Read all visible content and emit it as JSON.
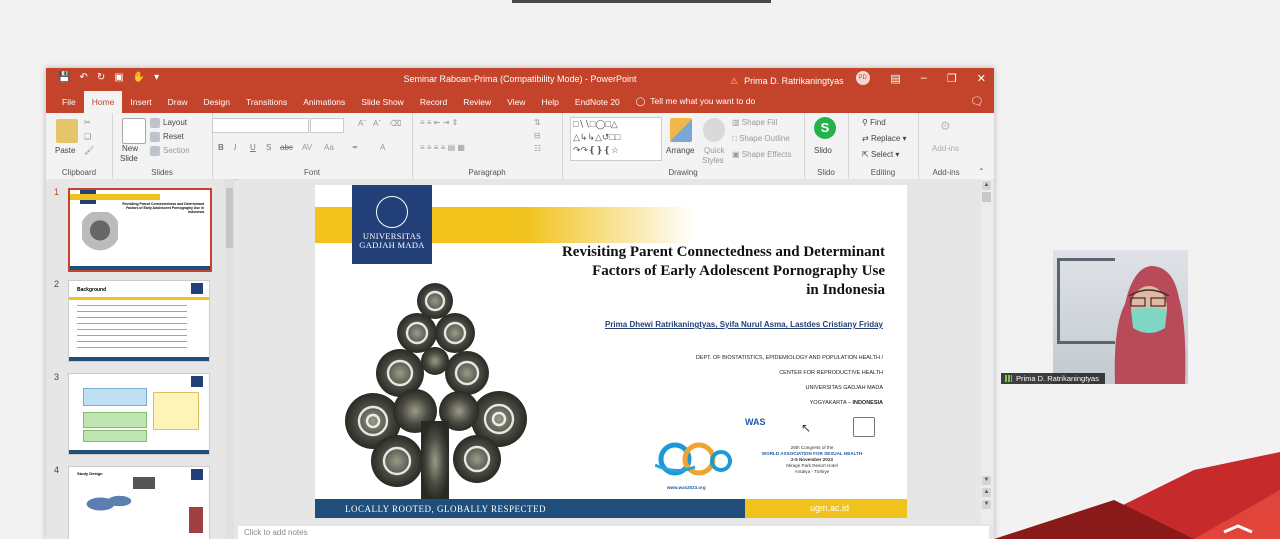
{
  "window": {
    "title": "Seminar Raboan-Prima (Compatibility Mode) - PowerPoint",
    "user_name": "Prima D. Ratrikaningtyas",
    "user_initials": "PD"
  },
  "tabs": [
    "File",
    "Home",
    "Insert",
    "Draw",
    "Design",
    "Transitions",
    "Animations",
    "Slide Show",
    "Record",
    "Review",
    "View",
    "Help",
    "EndNote 20"
  ],
  "active_tab": "Home",
  "tell_me": "Tell me what you want to do",
  "ribbon": {
    "clipboard": {
      "label": "Clipboard",
      "paste": "Paste"
    },
    "slides": {
      "label": "Slides",
      "new_slide_1": "New",
      "new_slide_2": "Slide",
      "layout": "Layout",
      "reset": "Reset",
      "section": "Section"
    },
    "font": {
      "label": "Font",
      "bold": "B",
      "italic": "I",
      "underline": "U",
      "shadow": "S",
      "strike": "abc"
    },
    "paragraph": {
      "label": "Paragraph"
    },
    "drawing": {
      "label": "Drawing",
      "arrange": "Arrange",
      "quick_styles_1": "Quick",
      "quick_styles_2": "Styles",
      "shape_fill": "Shape Fill",
      "shape_outline": "Shape Outline",
      "shape_effects": "Shape Effects"
    },
    "slido": {
      "label": "Slido",
      "button": "Slido"
    },
    "editing": {
      "label": "Editing",
      "find": "Find",
      "replace": "Replace",
      "select": "Select"
    },
    "addins": {
      "label": "Add-ins",
      "button": "Add-ins"
    }
  },
  "thumbnails": [
    {
      "number": "1",
      "heading": "Revisiting Parent Connectedness and Determinant Factors of Early Adolescent Pornography Use in Indonesia"
    },
    {
      "number": "2",
      "heading": "Background"
    },
    {
      "number": "3",
      "heading": ""
    },
    {
      "number": "4",
      "heading": "Study Design"
    }
  ],
  "slide": {
    "logo_line1": "UNIVERSITAS",
    "logo_line2": "GADJAH MADA",
    "title_line1": "Revisiting Parent Connectedness and Determinant",
    "title_line2": "Factors of Early Adolescent Pornography Use",
    "title_line3": "in Indonesia",
    "authors": "Prima Dhewi Ratrikaningtyas, Syifa Nurul Asma, Lastdes Cristiany Friday",
    "affiliation1": "DEPT. OF BIOSTATISTICS, EPIDEMIOLOGY AND POPULATION HEALTH /",
    "affiliation2": "CENTER FOR REPRODUCTIVE HEALTH",
    "affiliation3": "UNIVERSITAS GADJAH MADA",
    "affiliation4_prefix": "YOGYAKARTA – ",
    "affiliation4_country": "INDONESIA",
    "motto": "LOCALLY ROOTED, GLOBALLY RESPECTED",
    "url": "ugm.ac.id",
    "was_logo": "WAS",
    "congress_1": "26th Congress of the",
    "congress_2": "WORLD ASSOCIATION FOR SEXUAL HEALTH",
    "congress_3": "2-5 November 2023",
    "congress_4": "Mirage Park Resort Hotel",
    "congress_5": "Antalya - Türkiye",
    "congress_url": "www.was2023.org"
  },
  "notes_placeholder": "Click to add notes",
  "webcam": {
    "name": "Prima D. Ratrikaningtyas"
  },
  "colors": {
    "accent": "#c4432b",
    "ugm_blue": "#233f78",
    "ugm_yellow": "#f1c21b"
  }
}
